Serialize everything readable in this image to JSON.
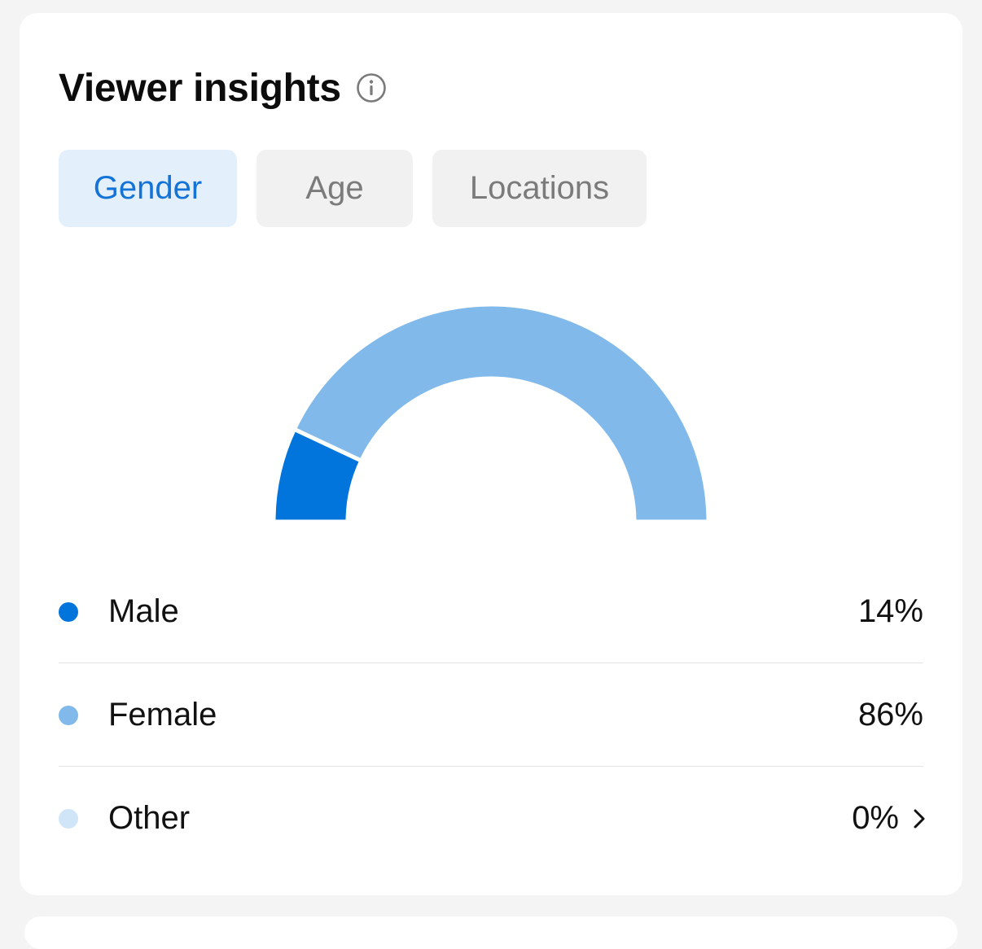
{
  "header": {
    "title": "Viewer insights",
    "info_icon": "info-circle-icon"
  },
  "tabs": [
    {
      "label": "Gender",
      "active": true
    },
    {
      "label": "Age",
      "active": false
    },
    {
      "label": "Locations",
      "active": false
    }
  ],
  "chart_data": {
    "type": "pie",
    "categories": [
      "Male",
      "Female",
      "Other"
    ],
    "values": [
      14,
      86,
      0
    ],
    "colors": [
      "#0175dc",
      "#80b9ea",
      "#d0e6f8"
    ]
  },
  "legend": [
    {
      "label": "Male",
      "value": "14%",
      "color": "#0175dc"
    },
    {
      "label": "Female",
      "value": "86%",
      "color": "#80b9ea"
    },
    {
      "label": "Other",
      "value": "0%",
      "color": "#d0e6f8",
      "chevron_icon": "chevron-right-icon"
    }
  ]
}
